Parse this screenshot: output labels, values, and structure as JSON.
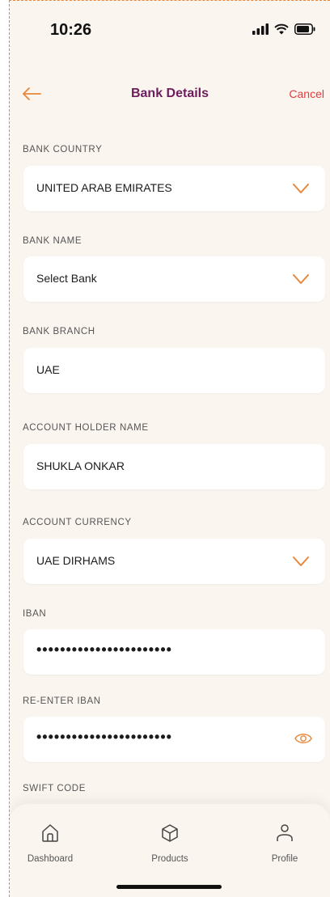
{
  "status": {
    "time": "10:26"
  },
  "header": {
    "title": "Bank Details",
    "cancel_label": "Cancel"
  },
  "fields": {
    "bank_country": {
      "label": "BANK COUNTRY",
      "value": "UNITED ARAB EMIRATES"
    },
    "bank_name": {
      "label": "BANK NAME",
      "value": "Select Bank"
    },
    "bank_branch": {
      "label": "BANK BRANCH",
      "value": "UAE"
    },
    "account_holder": {
      "label": "ACCOUNT HOLDER NAME",
      "value": "SHUKLA ONKAR"
    },
    "account_currency": {
      "label": "ACCOUNT CURRENCY",
      "value": "UAE DIRHAMS"
    },
    "iban": {
      "label": "IBAN",
      "value": "•••••••••••••••••••••••"
    },
    "reenter_iban": {
      "label": "RE-ENTER IBAN",
      "value": "•••••••••••••••••••••••"
    },
    "swift_code": {
      "label": "SWIFT CODE",
      "value": ""
    }
  },
  "tabbar": {
    "items": [
      {
        "label": "Dashboard",
        "icon": "home-icon"
      },
      {
        "label": "Products",
        "icon": "box-icon"
      },
      {
        "label": "Profile",
        "icon": "person-icon"
      }
    ]
  },
  "colors": {
    "accent": "#e8873a",
    "title": "#6d1d5c",
    "cancel": "#e23b3b",
    "background": "#fbf5f0"
  }
}
